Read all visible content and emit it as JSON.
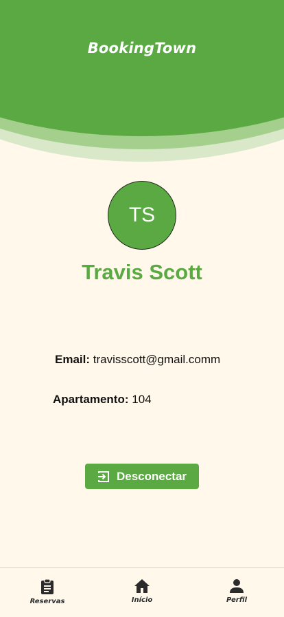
{
  "app": {
    "brand": "BookingTown"
  },
  "profile": {
    "initials": "TS",
    "name": "Travis Scott",
    "email_label": "Email:",
    "email_value": "travisscott@gmail.comm",
    "apartment_label": "Apartamento:",
    "apartment_value": "104"
  },
  "actions": {
    "logout_label": "Desconectar",
    "logout_icon": "logout-icon"
  },
  "tabbar": {
    "items": [
      {
        "label": "Reservas",
        "icon": "clipboard-icon"
      },
      {
        "label": "Início",
        "icon": "home-icon"
      },
      {
        "label": "Perfil",
        "icon": "person-icon"
      }
    ]
  },
  "colors": {
    "primary_green": "#5ba942",
    "wave_mid": "#a4cf8c",
    "wave_light": "#d8e8c8",
    "background": "#fff8eb",
    "text": "#111111"
  }
}
